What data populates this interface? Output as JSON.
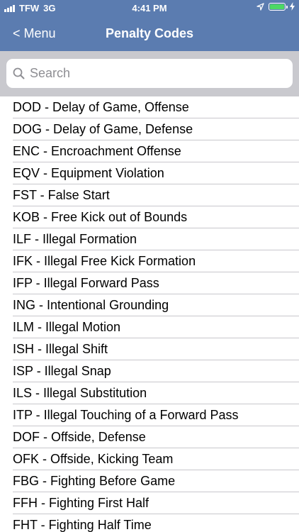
{
  "status_bar": {
    "carrier": "TFW",
    "network": "3G",
    "time": "4:41 PM",
    "battery_color": "#4cd964"
  },
  "nav": {
    "back_label": "< Menu",
    "title": "Penalty Codes",
    "bar_color": "#5b7cb0"
  },
  "search": {
    "placeholder": "Search"
  },
  "penalties": [
    "DOD - Delay of Game, Offense",
    "DOG - Delay of Game, Defense",
    "ENC - Encroachment Offense",
    "EQV - Equipment Violation",
    "FST - False Start",
    "KOB - Free Kick out of Bounds",
    "ILF - Illegal Formation",
    "IFK - Illegal Free Kick Formation",
    "IFP - Illegal Forward Pass",
    "ING - Intentional Grounding",
    "ILM - Illegal Motion",
    "ISH - Illegal Shift",
    "ISP - Illegal Snap",
    "ILS - Illegal Substitution",
    "ITP - Illegal Touching of a Forward Pass",
    "DOF - Offside, Defense",
    "OFK - Offside, Kicking Team",
    "FBG - Fighting Before Game",
    "FFH - Fighting First Half",
    "FHT - Fighting Half Time"
  ]
}
